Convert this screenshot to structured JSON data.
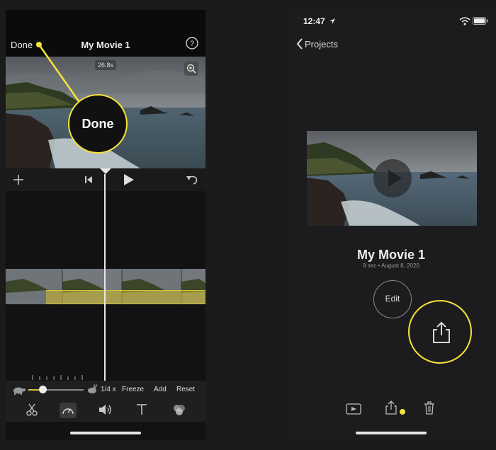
{
  "left_screen": {
    "done_label": "Done",
    "title": "My Movie 1",
    "duration_badge": "26.8s",
    "speed": {
      "value_label": "1/4 x",
      "freeze_label": "Freeze",
      "add_label": "Add",
      "reset_label": "Reset",
      "level": 0.25
    },
    "callout_label": "Done"
  },
  "right_screen": {
    "status_time": "12:47",
    "back_label": "Projects",
    "project_title": "My Movie 1",
    "project_meta": "9 sec • August 8, 2020",
    "edit_label": "Edit"
  },
  "colors": {
    "highlight": "#f5e43a",
    "background": "#1b1b1b",
    "audio_track": "#d6c33a"
  },
  "icons": [
    "help-icon",
    "zoom-icon",
    "add-icon",
    "rewind-icon",
    "play-icon",
    "undo-icon",
    "scissors-icon",
    "speed-icon",
    "volume-icon",
    "title-text-icon",
    "filters-icon",
    "turtle-icon",
    "rabbit-icon",
    "chevron-left-icon",
    "location-arrow-icon",
    "wifi-icon",
    "battery-icon",
    "share-icon",
    "trash-icon"
  ]
}
